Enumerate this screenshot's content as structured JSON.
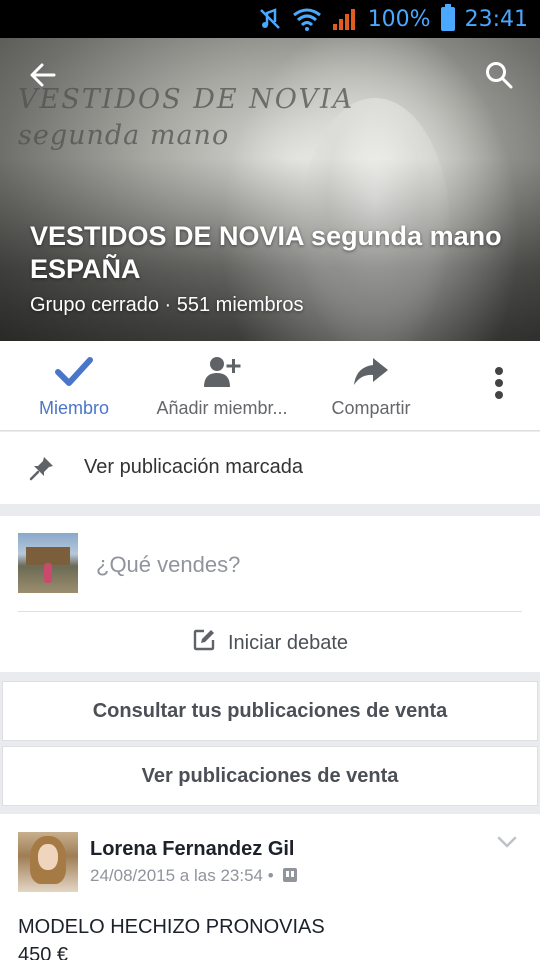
{
  "status_bar": {
    "battery": "100%",
    "time": "23:41"
  },
  "cover": {
    "watermark_line1": "VESTIDOS DE NOVIA",
    "watermark_line2": "segunda mano",
    "title": "VESTIDOS DE NOVIA segunda mano ESPAÑA",
    "subtitle": "Grupo cerrado · 551 miembros"
  },
  "actions": {
    "member": "Miembro",
    "add_member": "Añadir miembr...",
    "share": "Compartir"
  },
  "pinned": {
    "label": "Ver publicación marcada"
  },
  "composer": {
    "placeholder": "¿Qué vendes?",
    "start_debate": "Iniciar debate"
  },
  "buttons": {
    "my_sales": "Consultar tus publicaciones de venta",
    "all_sales": "Ver publicaciones de venta"
  },
  "post": {
    "author": "Lorena Fernandez Gil",
    "date": "24/08/2015 a las 23:54 •",
    "title": "MODELO HECHIZO PRONOVIAS",
    "price": "450 €"
  },
  "colors": {
    "accent": "#4a76c9",
    "status_icons": "#4aa8ff"
  }
}
